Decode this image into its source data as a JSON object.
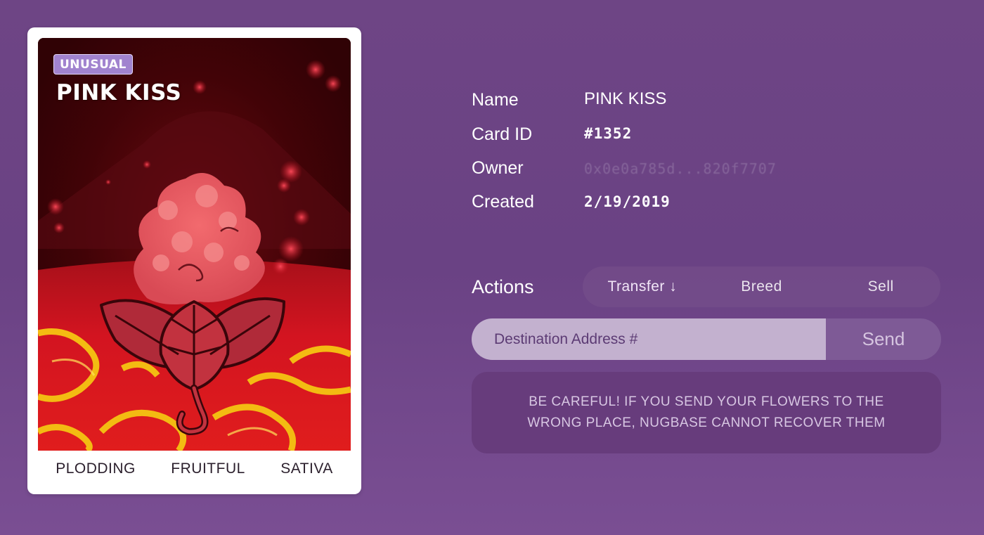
{
  "card": {
    "rarity": "UNUSUAL",
    "title": "PINK KISS",
    "traits": [
      "PLODDING",
      "FRUITFUL",
      "SATIVA"
    ]
  },
  "info": {
    "name_label": "Name",
    "name_value": "PINK KISS",
    "card_id_label": "Card ID",
    "card_id_value": "#1352",
    "owner_label": "Owner",
    "owner_value": "0x0e0a785d...820f7707",
    "created_label": "Created",
    "created_value": "2/19/2019"
  },
  "actions": {
    "label": "Actions",
    "tabs": [
      "Transfer ↓",
      "Breed",
      "Sell"
    ],
    "active_tab": "Transfer ↓",
    "destination_placeholder": "Destination Address #",
    "destination_value": "",
    "send_label": "Send",
    "warning": "BE CAREFUL! IF YOU SEND YOUR FLOWERS TO THE WRONG PLACE, NUGBASE CANNOT RECOVER THEM"
  },
  "colors": {
    "background": "#6b4384",
    "input": "#c3b1cf",
    "send_button": "#7e5a96",
    "warning_box": "#673c7c",
    "rarity_badge": "#a183cf"
  },
  "icons": [
    "flower-illustration",
    "down-arrow-icon"
  ]
}
